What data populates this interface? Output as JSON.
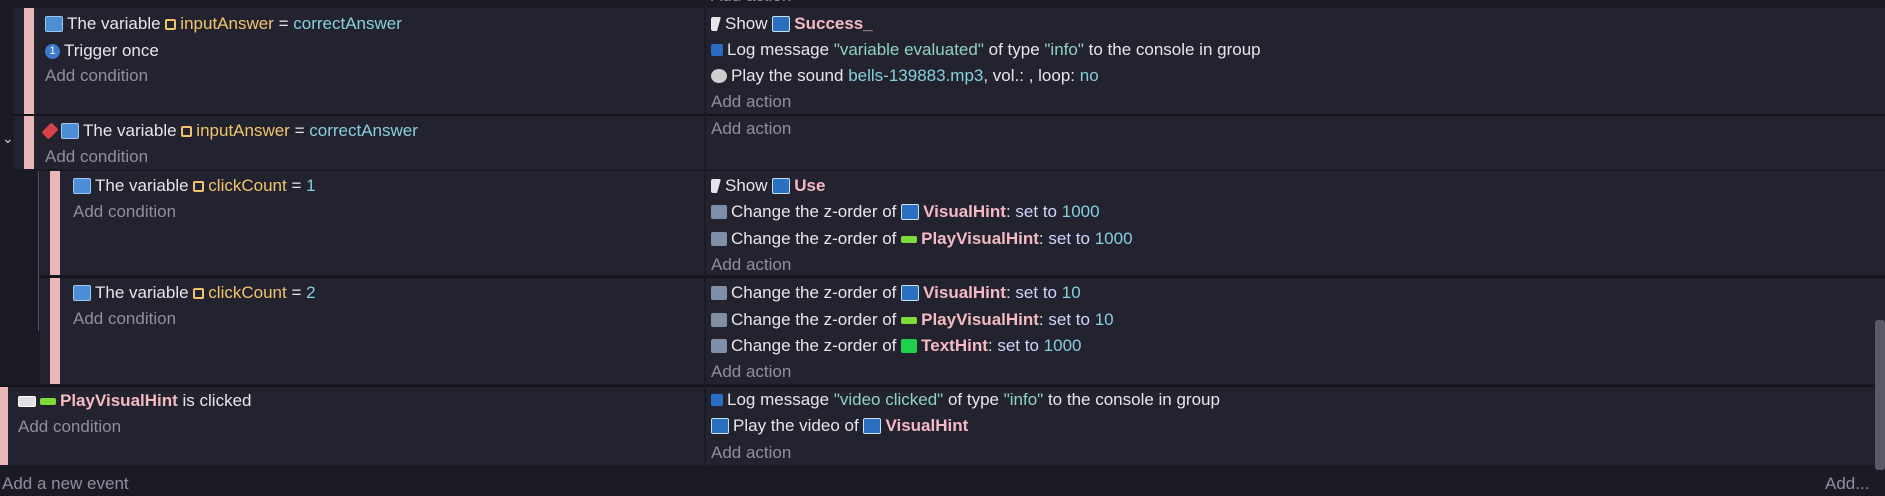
{
  "top_cut_label": "Add action",
  "event1": {
    "conditions": [
      {
        "prefix": "The variable",
        "var": "inputAnswer",
        "op": "=",
        "value": "correctAnswer"
      },
      {
        "text": "Trigger once"
      }
    ],
    "add_condition": "Add condition",
    "actions": [
      {
        "text": "Show",
        "object": "Success_"
      },
      {
        "pre": "Log message",
        "msg": "\"variable evaluated\"",
        "mid": "of type",
        "type": "\"info\"",
        "post": "to the console in group"
      },
      {
        "pre": "Play the sound",
        "file": "bells-139883.mp3",
        "mid": ", vol.: , loop:",
        "loop": "no"
      }
    ],
    "add_action": "Add action"
  },
  "event2": {
    "condition": {
      "prefix": "The variable",
      "var": "inputAnswer",
      "op": "=",
      "value": "correctAnswer"
    },
    "add_condition": "Add condition",
    "add_action": "Add action"
  },
  "sub1": {
    "condition": {
      "prefix": "The variable",
      "var": "clickCount",
      "op": "=",
      "value": "1"
    },
    "add_condition": "Add condition",
    "actions": [
      {
        "text": "Show",
        "object": "Use"
      },
      {
        "pre": "Change the z-order of",
        "object": "VisualHint",
        "sep": ":",
        "set": "set to",
        "value": "1000"
      },
      {
        "pre": "Change the z-order of",
        "object": "PlayVisualHint",
        "sep": ":",
        "set": "set to",
        "value": "1000"
      }
    ],
    "add_action": "Add action"
  },
  "sub2": {
    "condition": {
      "prefix": "The variable",
      "var": "clickCount",
      "op": "=",
      "value": "2"
    },
    "add_condition": "Add condition",
    "actions": [
      {
        "pre": "Change the z-order of",
        "object": "VisualHint",
        "sep": ":",
        "set": "set to",
        "value": "10"
      },
      {
        "pre": "Change the z-order of",
        "object": "PlayVisualHint",
        "sep": ":",
        "set": "set to",
        "value": "10"
      },
      {
        "pre": "Change the z-order of",
        "object": "TextHint",
        "sep": ":",
        "set": "set to",
        "value": "1000"
      }
    ],
    "add_action": "Add action"
  },
  "event3": {
    "condition": {
      "object": "PlayVisualHint",
      "text": "is clicked"
    },
    "add_condition": "Add condition",
    "actions": [
      {
        "pre": "Log message",
        "msg": "\"video clicked\"",
        "mid": "of type",
        "type": "\"info\"",
        "post": "to the console in group"
      },
      {
        "pre": "Play the video of",
        "object": "VisualHint"
      }
    ],
    "add_action": "Add action"
  },
  "footer": {
    "left": "Add a new event",
    "right": "Add..."
  },
  "colors": {
    "bg": "#1b1b26",
    "block": "#232330",
    "bar": "#e8b8b8",
    "variable": "#f0c46a",
    "value": "#86cfe0",
    "object": "#f4b9c4"
  }
}
